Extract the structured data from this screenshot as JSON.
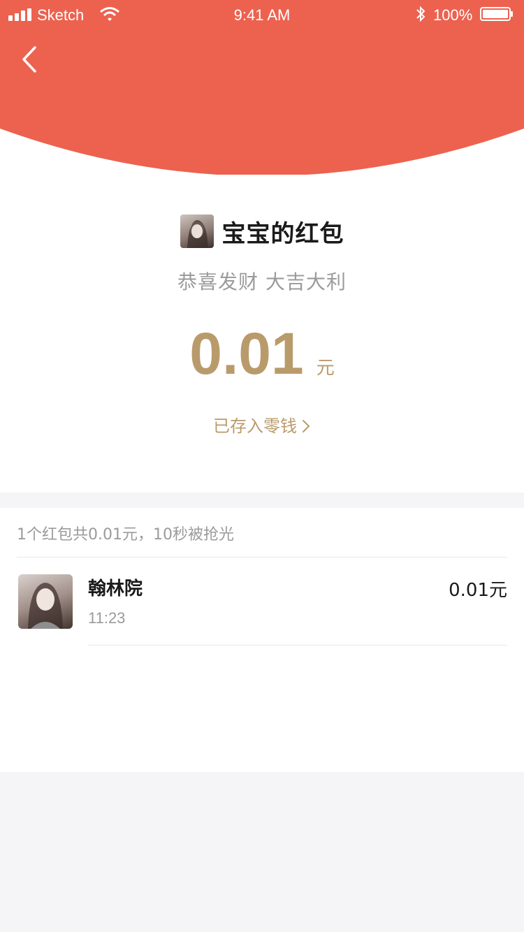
{
  "status_bar": {
    "carrier": "Sketch",
    "time": "9:41 AM",
    "battery": "100%"
  },
  "header": {
    "back_icon": "chevron-left-icon",
    "background_color": "#ec624f"
  },
  "envelope": {
    "sender_name": "宝宝的红包",
    "blessing": "恭喜发财 大吉大利",
    "amount": "0.01",
    "amount_unit": "元",
    "saved_link": "已存入零钱",
    "accent_color": "#b99b6b"
  },
  "list": {
    "summary": "1个红包共0.01元，10秒被抢光",
    "records": [
      {
        "name": "翰林院",
        "time": "11:23",
        "amount": "0.01元"
      }
    ]
  }
}
